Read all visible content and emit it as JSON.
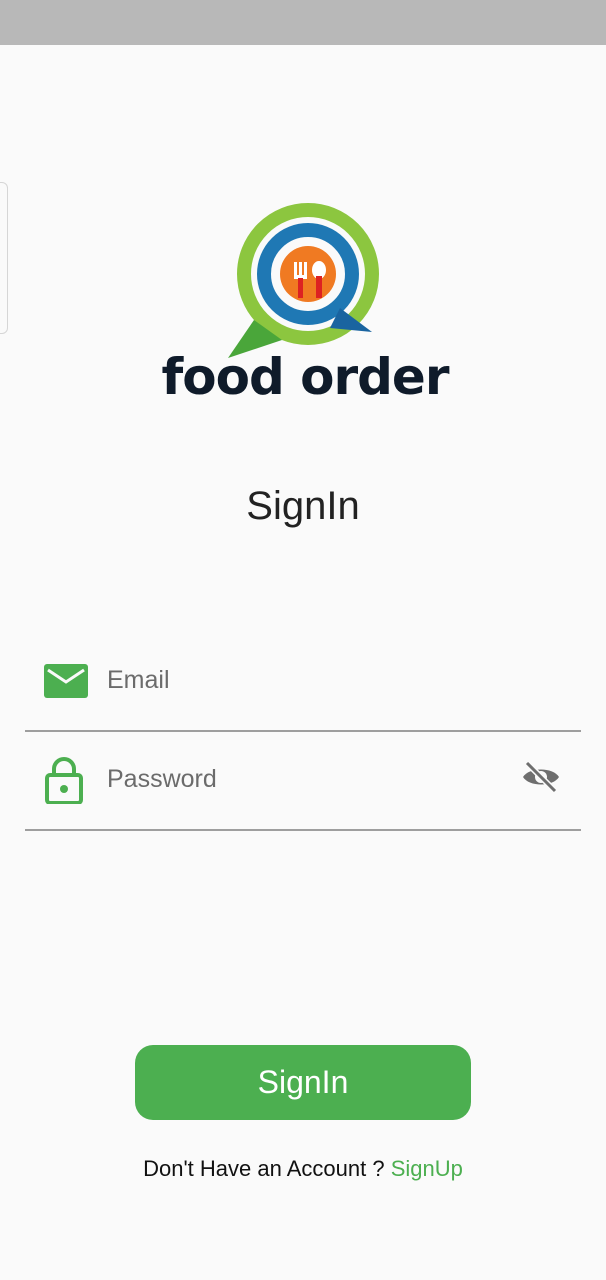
{
  "logo": {
    "text": "food order",
    "icon": "food-order-logo-icon"
  },
  "title": "SignIn",
  "email_field": {
    "placeholder": "Email",
    "icon": "mail-icon"
  },
  "password_field": {
    "placeholder": "Password",
    "icon": "lock-icon",
    "toggle_icon": "eye-off-icon"
  },
  "signin_button": {
    "label": "SignIn"
  },
  "footer": {
    "prompt": "Don't Have an Account ? ",
    "link": "SignUp"
  },
  "colors": {
    "accent": "#4caf50",
    "background": "#fafafa",
    "status_bar": "#b8b8b8"
  }
}
